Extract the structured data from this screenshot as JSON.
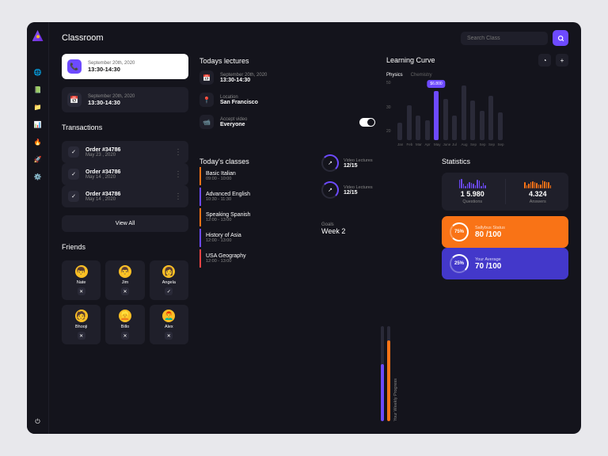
{
  "header": {
    "title": "Classroom",
    "search_placeholder": "Search Class"
  },
  "schedule": [
    {
      "date": "September 20th, 2020",
      "time": "13:30-14:30"
    },
    {
      "date": "September 20th, 2020",
      "time": "13:30-14:30"
    }
  ],
  "transactions": {
    "title": "Transactions",
    "items": [
      {
        "order": "Order #34786",
        "date": "May 23 , 2020"
      },
      {
        "order": "Order #34786",
        "date": "May 14 , 2020"
      },
      {
        "order": "Order #34786",
        "date": "May 14 , 2020"
      }
    ],
    "view_all": "View All"
  },
  "friends": {
    "title": "Friends",
    "items": [
      {
        "name": "Nate",
        "emoji": "👦",
        "action": "✕"
      },
      {
        "name": "Jim",
        "emoji": "👨",
        "action": "✕"
      },
      {
        "name": "Angela",
        "emoji": "👩",
        "action": "✓"
      },
      {
        "name": "Bhooji",
        "emoji": "🧑",
        "action": "✕"
      },
      {
        "name": "Billo",
        "emoji": "👱",
        "action": "✕"
      },
      {
        "name": "Alex",
        "emoji": "👨‍🦰",
        "action": "✕"
      }
    ]
  },
  "lectures": {
    "title": "Todays lectures",
    "items": [
      {
        "label": "September 20th, 2020",
        "value": "13:30-14:30",
        "icon": "📅"
      },
      {
        "label": "Location",
        "value": "San Francisco",
        "icon": "📍"
      },
      {
        "label": "Accept video",
        "value": "Everyone",
        "icon": "📹",
        "toggle": true
      }
    ]
  },
  "curve": {
    "title": "Learning Curve",
    "tabs": [
      "Physics",
      "Chemistry"
    ],
    "tooltip": "$6.800"
  },
  "chart_data": {
    "type": "bar",
    "categories": [
      "Jan",
      "Feb",
      "Mar",
      "Apr",
      "May",
      "June",
      "Jul",
      "Aug",
      "Sep",
      "Sep",
      "Sep",
      "Sep"
    ],
    "values": [
      18,
      35,
      25,
      20,
      50,
      42,
      25,
      55,
      40,
      30,
      45,
      28
    ],
    "highlight_index": 4,
    "highlight_value": "$6.800",
    "y_ticks": [
      "50",
      "30",
      "20"
    ],
    "ylim": [
      0,
      60
    ]
  },
  "classes": {
    "title": "Today's classes",
    "items": [
      {
        "name": "Basic Italian",
        "time": "09:00 - 10:00",
        "color": "#f97316"
      },
      {
        "name": "Advanced English",
        "time": "10:30 - 11:30",
        "color": "#6d4aff"
      },
      {
        "name": "Speaking Spanish",
        "time": "12:00 - 13:00",
        "color": "#f97316"
      },
      {
        "name": "History of Asia",
        "time": "12:00 - 13:00",
        "color": "#6d4aff"
      },
      {
        "name": "USA Geography",
        "time": "12:00 - 13:00",
        "color": "#ef4444"
      }
    ]
  },
  "progress": {
    "rings": [
      {
        "label": "Video Lectures",
        "value": "12/15"
      },
      {
        "label": "Video Lectures",
        "value": "12/15"
      }
    ],
    "goals_label": "Goals",
    "goals_value": "Week 2",
    "vlabel": "Your Weekly Progress",
    "bars": [
      {
        "fill": 60,
        "color": "#6d4aff"
      },
      {
        "fill": 85,
        "color": "#f97316"
      }
    ]
  },
  "stats": {
    "title": "Statistics",
    "questions": {
      "value": "1 5.980",
      "label": "Questions",
      "color": "#6d4aff"
    },
    "answers": {
      "value": "4.324",
      "label": "Answers",
      "color": "#f97316"
    },
    "cards": [
      {
        "pct": "75%",
        "label": "Sallybus Status",
        "value": "80 /100",
        "bg": "orange"
      },
      {
        "pct": "25%",
        "label": "Your Average",
        "value": "70 /100",
        "bg": "blue"
      }
    ]
  }
}
